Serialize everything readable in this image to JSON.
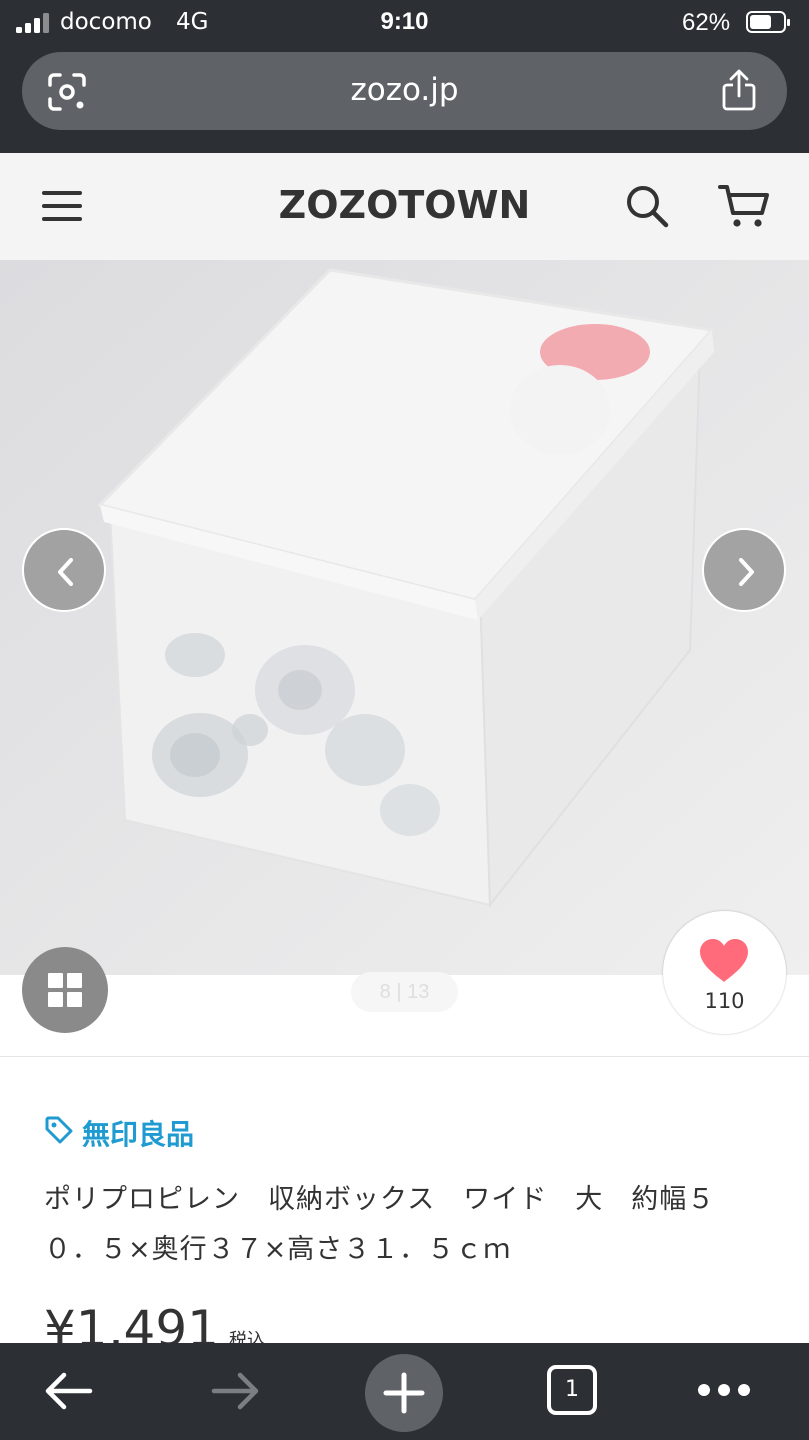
{
  "status_bar": {
    "carrier": "docomo",
    "network": "4G",
    "time": "9:10",
    "battery_percent": "62%",
    "battery_level": 0.62
  },
  "browser": {
    "url": "zozo.jp",
    "left_icon": "lens-scan-icon",
    "share_icon": "share-icon"
  },
  "site_header": {
    "logo": "ZOZOTOWN",
    "menu_icon": "hamburger-menu-icon",
    "search_icon": "search-icon",
    "cart_icon": "cart-icon"
  },
  "gallery": {
    "pager": "8 | 13",
    "favorite_count": "110",
    "grid_icon": "grid-icon",
    "heart_color": "#ff6b7a"
  },
  "product": {
    "brand": "無印良品",
    "title": "ポリプロピレン　収納ボックス　ワイド　大　約幅５０．５×奥行３７×高さ３１．５ｃｍ",
    "price": "¥1,491",
    "price_tax": "税込"
  },
  "toolbar": {
    "tab_count": "1"
  },
  "colors": {
    "accent": "#1f9bd1",
    "chrome_bg": "#2c3034",
    "url_bar_bg": "#5f6368"
  }
}
